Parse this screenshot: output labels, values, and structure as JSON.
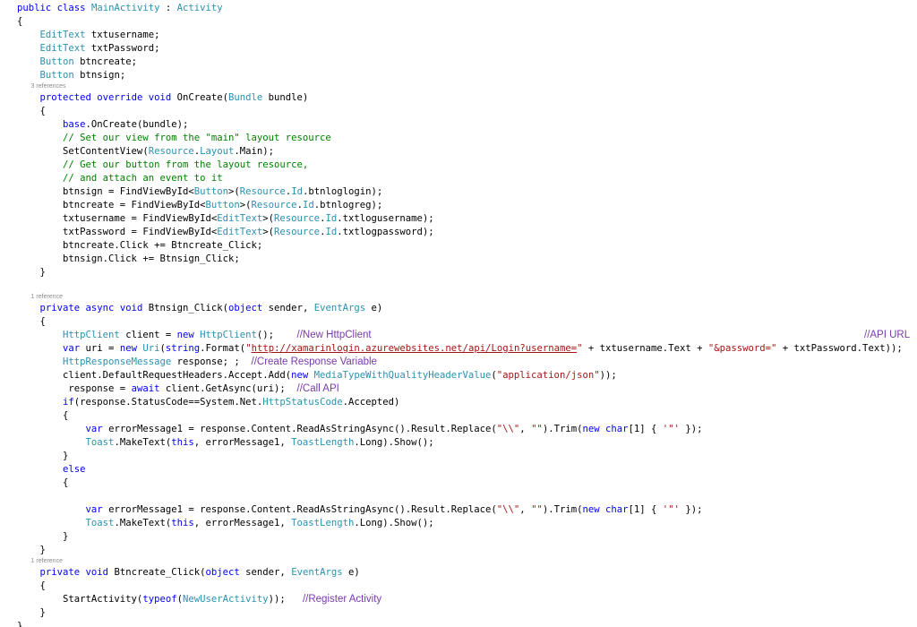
{
  "code_lines": [
    {
      "id": "class-decl",
      "type": "code",
      "tokens": [
        {
          "t": "kw",
          "v": "public "
        },
        {
          "t": "kw",
          "v": "class "
        },
        {
          "t": "ty",
          "v": "MainActivity"
        },
        {
          "t": "",
          "v": " : "
        },
        {
          "t": "ty",
          "v": "Activity"
        }
      ]
    },
    {
      "id": "brace",
      "type": "code",
      "tokens": [
        {
          "t": "",
          "v": "{"
        }
      ]
    },
    {
      "id": "field",
      "type": "code",
      "tokens": [
        {
          "t": "",
          "v": "    "
        },
        {
          "t": "ty",
          "v": "EditText"
        },
        {
          "t": "",
          "v": " txtusername;"
        }
      ]
    },
    {
      "id": "field",
      "type": "code",
      "tokens": [
        {
          "t": "",
          "v": "    "
        },
        {
          "t": "ty",
          "v": "EditText"
        },
        {
          "t": "",
          "v": " txtPassword;"
        }
      ]
    },
    {
      "id": "field",
      "type": "code",
      "tokens": [
        {
          "t": "",
          "v": "    "
        },
        {
          "t": "ty",
          "v": "Button"
        },
        {
          "t": "",
          "v": " btncreate;"
        }
      ]
    },
    {
      "id": "field",
      "type": "code",
      "tokens": [
        {
          "t": "",
          "v": "    "
        },
        {
          "t": "ty",
          "v": "Button"
        },
        {
          "t": "",
          "v": " btnsign;"
        }
      ]
    },
    {
      "id": "codelens",
      "type": "lens",
      "tokens": [
        {
          "t": "",
          "v": "        3 references"
        }
      ]
    },
    {
      "id": "method-sig",
      "type": "code",
      "tokens": [
        {
          "t": "",
          "v": "    "
        },
        {
          "t": "kw",
          "v": "protected "
        },
        {
          "t": "kw",
          "v": "override "
        },
        {
          "t": "kw",
          "v": "void "
        },
        {
          "t": "",
          "v": "OnCreate("
        },
        {
          "t": "ty",
          "v": "Bundle"
        },
        {
          "t": "",
          "v": " bundle)"
        }
      ]
    },
    {
      "id": "brace",
      "type": "code",
      "tokens": [
        {
          "t": "",
          "v": "    {"
        }
      ]
    },
    {
      "id": "stmt",
      "type": "code",
      "tokens": [
        {
          "t": "",
          "v": "        "
        },
        {
          "t": "kw",
          "v": "base"
        },
        {
          "t": "",
          "v": ".OnCreate(bundle);"
        }
      ]
    },
    {
      "id": "comment",
      "type": "code",
      "tokens": [
        {
          "t": "",
          "v": "        "
        },
        {
          "t": "cmt",
          "v": "// Set our view from the \"main\" layout resource"
        }
      ]
    },
    {
      "id": "stmt",
      "type": "code",
      "tokens": [
        {
          "t": "",
          "v": "        SetContentView("
        },
        {
          "t": "ty",
          "v": "Resource"
        },
        {
          "t": "",
          "v": "."
        },
        {
          "t": "ty",
          "v": "Layout"
        },
        {
          "t": "",
          "v": ".Main);"
        }
      ]
    },
    {
      "id": "comment",
      "type": "code",
      "tokens": [
        {
          "t": "",
          "v": "        "
        },
        {
          "t": "cmt",
          "v": "// Get our button from the layout resource,"
        }
      ]
    },
    {
      "id": "comment",
      "type": "code",
      "tokens": [
        {
          "t": "",
          "v": "        "
        },
        {
          "t": "cmt",
          "v": "// and attach an event to it"
        }
      ]
    },
    {
      "id": "stmt",
      "type": "code",
      "tokens": [
        {
          "t": "",
          "v": "        btnsign = FindViewById<"
        },
        {
          "t": "ty",
          "v": "Button"
        },
        {
          "t": "",
          "v": ">("
        },
        {
          "t": "ty",
          "v": "Resource"
        },
        {
          "t": "",
          "v": "."
        },
        {
          "t": "ty",
          "v": "Id"
        },
        {
          "t": "",
          "v": ".btnloglogin);"
        }
      ]
    },
    {
      "id": "stmt",
      "type": "code",
      "tokens": [
        {
          "t": "",
          "v": "        btncreate = FindViewById<"
        },
        {
          "t": "ty",
          "v": "Button"
        },
        {
          "t": "",
          "v": ">("
        },
        {
          "t": "ty",
          "v": "Resource"
        },
        {
          "t": "",
          "v": "."
        },
        {
          "t": "ty",
          "v": "Id"
        },
        {
          "t": "",
          "v": ".btnlogreg);"
        }
      ]
    },
    {
      "id": "stmt",
      "type": "code",
      "tokens": [
        {
          "t": "",
          "v": "        txtusername = FindViewById<"
        },
        {
          "t": "ty",
          "v": "EditText"
        },
        {
          "t": "",
          "v": ">("
        },
        {
          "t": "ty",
          "v": "Resource"
        },
        {
          "t": "",
          "v": "."
        },
        {
          "t": "ty",
          "v": "Id"
        },
        {
          "t": "",
          "v": ".txtlogusername);"
        }
      ]
    },
    {
      "id": "stmt",
      "type": "code",
      "tokens": [
        {
          "t": "",
          "v": "        txtPassword = FindViewById<"
        },
        {
          "t": "ty",
          "v": "EditText"
        },
        {
          "t": "",
          "v": ">("
        },
        {
          "t": "ty",
          "v": "Resource"
        },
        {
          "t": "",
          "v": "."
        },
        {
          "t": "ty",
          "v": "Id"
        },
        {
          "t": "",
          "v": ".txtlogpassword);"
        }
      ]
    },
    {
      "id": "stmt",
      "type": "code",
      "tokens": [
        {
          "t": "",
          "v": "        btncreate.Click += Btncreate_Click;"
        }
      ]
    },
    {
      "id": "stmt",
      "type": "code",
      "tokens": [
        {
          "t": "",
          "v": "        btnsign.Click += Btnsign_Click;"
        }
      ]
    },
    {
      "id": "brace",
      "type": "code",
      "tokens": [
        {
          "t": "",
          "v": "    }"
        }
      ]
    },
    {
      "id": "blank",
      "type": "code",
      "tokens": [
        {
          "t": "",
          "v": ""
        }
      ]
    },
    {
      "id": "codelens",
      "type": "lens",
      "tokens": [
        {
          "t": "",
          "v": "        1 reference"
        }
      ]
    },
    {
      "id": "method-sig",
      "type": "code",
      "tokens": [
        {
          "t": "",
          "v": "    "
        },
        {
          "t": "kw",
          "v": "private "
        },
        {
          "t": "kw",
          "v": "async "
        },
        {
          "t": "kw",
          "v": "void "
        },
        {
          "t": "",
          "v": "Btnsign_Click("
        },
        {
          "t": "kw",
          "v": "object"
        },
        {
          "t": "",
          "v": " sender, "
        },
        {
          "t": "ty",
          "v": "EventArgs"
        },
        {
          "t": "",
          "v": " e)"
        }
      ]
    },
    {
      "id": "brace",
      "type": "code",
      "tokens": [
        {
          "t": "",
          "v": "    {"
        }
      ]
    },
    {
      "id": "stmt",
      "type": "code",
      "tokens": [
        {
          "t": "",
          "v": "        "
        },
        {
          "t": "ty",
          "v": "HttpClient"
        },
        {
          "t": "",
          "v": " client = "
        },
        {
          "t": "kw",
          "v": "new "
        },
        {
          "t": "ty",
          "v": "HttpClient"
        },
        {
          "t": "",
          "v": "();    "
        },
        {
          "t": "nt",
          "v": "//New HttpClient"
        },
        {
          "t": "nr",
          "v": "//API URL"
        }
      ]
    },
    {
      "id": "stmt",
      "type": "code",
      "tokens": [
        {
          "t": "",
          "v": "        "
        },
        {
          "t": "kw",
          "v": "var"
        },
        {
          "t": "",
          "v": " uri = "
        },
        {
          "t": "kw",
          "v": "new "
        },
        {
          "t": "ty",
          "v": "Uri"
        },
        {
          "t": "",
          "v": "("
        },
        {
          "t": "kw",
          "v": "string"
        },
        {
          "t": "",
          "v": ".Format("
        },
        {
          "t": "str",
          "v": "\""
        },
        {
          "t": "url",
          "v": "http://xamarinlogin.azurewebsites.net/api/Login?username="
        },
        {
          "t": "str",
          "v": "\""
        },
        {
          "t": "",
          "v": " + txtusername.Text + "
        },
        {
          "t": "str",
          "v": "\"&password=\""
        },
        {
          "t": "",
          "v": " + txtPassword.Text));"
        }
      ]
    },
    {
      "id": "stmt",
      "type": "code",
      "tokens": [
        {
          "t": "",
          "v": "        "
        },
        {
          "t": "ty",
          "v": "HttpResponseMessage"
        },
        {
          "t": "",
          "v": " response; ;  "
        },
        {
          "t": "nt",
          "v": "//Create Response Variable"
        }
      ]
    },
    {
      "id": "stmt",
      "type": "code",
      "tokens": [
        {
          "t": "",
          "v": "        client.DefaultRequestHeaders.Accept.Add("
        },
        {
          "t": "kw",
          "v": "new "
        },
        {
          "t": "ty",
          "v": "MediaTypeWithQualityHeaderValue"
        },
        {
          "t": "",
          "v": "("
        },
        {
          "t": "str",
          "v": "\"application/json\""
        },
        {
          "t": "",
          "v": "));"
        }
      ]
    },
    {
      "id": "stmt",
      "type": "code",
      "tokens": [
        {
          "t": "",
          "v": "         response = "
        },
        {
          "t": "kw",
          "v": "await "
        },
        {
          "t": "",
          "v": "client.GetAsync(uri);  "
        },
        {
          "t": "nt",
          "v": "//Call API"
        }
      ]
    },
    {
      "id": "stmt",
      "type": "code",
      "tokens": [
        {
          "t": "",
          "v": "        "
        },
        {
          "t": "kw",
          "v": "if"
        },
        {
          "t": "",
          "v": "(response.StatusCode==System.Net."
        },
        {
          "t": "ty",
          "v": "HttpStatusCode"
        },
        {
          "t": "",
          "v": ".Accepted)"
        }
      ]
    },
    {
      "id": "brace",
      "type": "code",
      "tokens": [
        {
          "t": "",
          "v": "        {"
        }
      ]
    },
    {
      "id": "stmt",
      "type": "code",
      "tokens": [
        {
          "t": "",
          "v": "            "
        },
        {
          "t": "kw",
          "v": "var"
        },
        {
          "t": "",
          "v": " errorMessage1 = response.Content.ReadAsStringAsync().Result.Replace("
        },
        {
          "t": "str",
          "v": "\"\\\\\""
        },
        {
          "t": "",
          "v": ", "
        },
        {
          "t": "str",
          "v": "\"\""
        },
        {
          "t": "",
          "v": ").Trim("
        },
        {
          "t": "kw",
          "v": "new "
        },
        {
          "t": "kw",
          "v": "char"
        },
        {
          "t": "",
          "v": "[1] { "
        },
        {
          "t": "str",
          "v": "'\"'"
        },
        {
          "t": "",
          "v": " });"
        }
      ]
    },
    {
      "id": "stmt",
      "type": "code",
      "tokens": [
        {
          "t": "",
          "v": "            "
        },
        {
          "t": "ty",
          "v": "Toast"
        },
        {
          "t": "",
          "v": ".MakeText("
        },
        {
          "t": "kw",
          "v": "this"
        },
        {
          "t": "",
          "v": ", errorMessage1, "
        },
        {
          "t": "ty",
          "v": "ToastLength"
        },
        {
          "t": "",
          "v": ".Long).Show();"
        }
      ]
    },
    {
      "id": "brace",
      "type": "code",
      "tokens": [
        {
          "t": "",
          "v": "        }"
        }
      ]
    },
    {
      "id": "stmt",
      "type": "code",
      "tokens": [
        {
          "t": "",
          "v": "        "
        },
        {
          "t": "kw",
          "v": "else"
        }
      ]
    },
    {
      "id": "brace",
      "type": "code",
      "tokens": [
        {
          "t": "",
          "v": "        {"
        }
      ]
    },
    {
      "id": "blank",
      "type": "code",
      "tokens": [
        {
          "t": "",
          "v": ""
        }
      ]
    },
    {
      "id": "stmt",
      "type": "code",
      "tokens": [
        {
          "t": "",
          "v": "            "
        },
        {
          "t": "kw",
          "v": "var"
        },
        {
          "t": "",
          "v": " errorMessage1 = response.Content.ReadAsStringAsync().Result.Replace("
        },
        {
          "t": "str",
          "v": "\"\\\\\""
        },
        {
          "t": "",
          "v": ", "
        },
        {
          "t": "str",
          "v": "\"\""
        },
        {
          "t": "",
          "v": ").Trim("
        },
        {
          "t": "kw",
          "v": "new "
        },
        {
          "t": "kw",
          "v": "char"
        },
        {
          "t": "",
          "v": "[1] { "
        },
        {
          "t": "str",
          "v": "'\"'"
        },
        {
          "t": "",
          "v": " });"
        }
      ]
    },
    {
      "id": "stmt",
      "type": "code",
      "tokens": [
        {
          "t": "",
          "v": "            "
        },
        {
          "t": "ty",
          "v": "Toast"
        },
        {
          "t": "",
          "v": ".MakeText("
        },
        {
          "t": "kw",
          "v": "this"
        },
        {
          "t": "",
          "v": ", errorMessage1, "
        },
        {
          "t": "ty",
          "v": "ToastLength"
        },
        {
          "t": "",
          "v": ".Long).Show();"
        }
      ]
    },
    {
      "id": "brace",
      "type": "code",
      "tokens": [
        {
          "t": "",
          "v": "        }"
        }
      ]
    },
    {
      "id": "brace",
      "type": "code",
      "tokens": [
        {
          "t": "",
          "v": "    }"
        }
      ]
    },
    {
      "id": "codelens",
      "type": "lens",
      "tokens": [
        {
          "t": "",
          "v": "        1 reference"
        }
      ]
    },
    {
      "id": "method-sig",
      "type": "code",
      "tokens": [
        {
          "t": "",
          "v": "    "
        },
        {
          "t": "kw",
          "v": "private "
        },
        {
          "t": "kw",
          "v": "void "
        },
        {
          "t": "",
          "v": "Btncreate_Click("
        },
        {
          "t": "kw",
          "v": "object"
        },
        {
          "t": "",
          "v": " sender, "
        },
        {
          "t": "ty",
          "v": "EventArgs"
        },
        {
          "t": "",
          "v": " e)"
        }
      ]
    },
    {
      "id": "brace",
      "type": "code",
      "tokens": [
        {
          "t": "",
          "v": "    {"
        }
      ]
    },
    {
      "id": "stmt",
      "type": "code",
      "tokens": [
        {
          "t": "",
          "v": "        StartActivity("
        },
        {
          "t": "kw",
          "v": "typeof"
        },
        {
          "t": "",
          "v": "("
        },
        {
          "t": "ty",
          "v": "NewUserActivity"
        },
        {
          "t": "",
          "v": "));   "
        },
        {
          "t": "nt",
          "v": "//Register Activity"
        }
      ]
    },
    {
      "id": "brace",
      "type": "code",
      "tokens": [
        {
          "t": "",
          "v": "    }"
        }
      ]
    },
    {
      "id": "brace",
      "type": "code",
      "tokens": [
        {
          "t": "",
          "v": "}"
        }
      ]
    }
  ],
  "colors": {
    "background": "#ffffff",
    "keyword": "#0000ff",
    "type": "#2b91af",
    "string": "#a31515",
    "comment": "#008000",
    "note": "#7a3aa8",
    "codelens": "#8c8c8c"
  }
}
